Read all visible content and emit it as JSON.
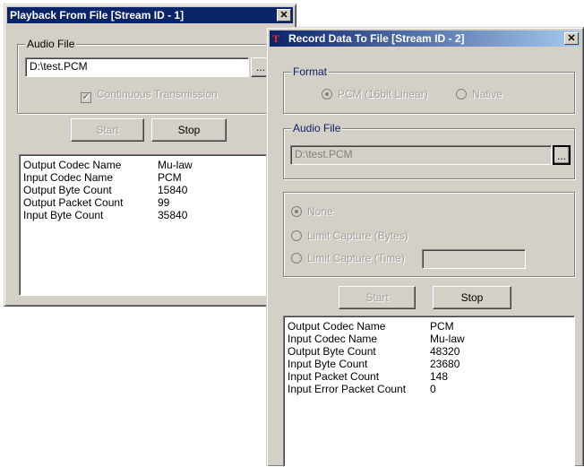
{
  "playback_window": {
    "title": "Playback From File [Stream ID - 1]",
    "close_glyph": "✕",
    "audio_file_group_label": "Audio File",
    "file_path": "D:\\test.PCM",
    "browse_glyph": "...",
    "continuous_label": "Continuous Transmission",
    "start_label": "Start",
    "stop_label": "Stop",
    "stats": [
      {
        "name": "Output Codec Name",
        "value": "Mu-law"
      },
      {
        "name": "Input Codec Name",
        "value": "PCM"
      },
      {
        "name": "Output Byte Count",
        "value": "15840"
      },
      {
        "name": "Output Packet Count",
        "value": "99"
      },
      {
        "name": "Input Byte Count",
        "value": "35840"
      }
    ]
  },
  "record_window": {
    "title": "Record Data To File [Stream ID - 2]",
    "app_icon": "T",
    "close_glyph": "✕",
    "format_group_label": "Format",
    "format_pcm_label": "PCM (16bit Linear)",
    "format_native_label": "Native",
    "audio_file_group_label": "Audio File",
    "file_path": "D:\\test.PCM",
    "browse_glyph": "...",
    "capture_none_label": "None",
    "capture_bytes_label": "Limit Capture (Bytes)",
    "capture_time_label": "Limit Capture (Time)",
    "capture_time_value": "",
    "start_label": "Start",
    "stop_label": "Stop",
    "stats": [
      {
        "name": "Output Codec Name",
        "value": "PCM"
      },
      {
        "name": "Input Codec Name",
        "value": "Mu-law"
      },
      {
        "name": "Output Byte Count",
        "value": "48320"
      },
      {
        "name": "Input Byte Count",
        "value": "23680"
      },
      {
        "name": "Input Packet Count",
        "value": "148"
      },
      {
        "name": "Input Error Packet Count",
        "value": "0"
      }
    ]
  },
  "colors": {
    "window_face": "#d4d0c8",
    "active_title_start": "#0a246a",
    "active_title_end": "#a6caf0",
    "group_label_blue": "#0a246a",
    "app_icon_red": "#ff2020"
  }
}
